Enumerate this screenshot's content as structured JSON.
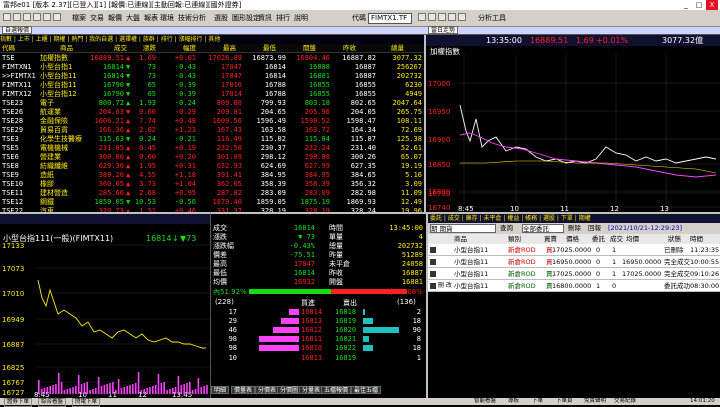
{
  "window": {
    "title": "富邦e01 [版本 2.37][已登入][1] [報價:已連線][主動回報:已連線][國外證券]",
    "min": "_",
    "max": "□",
    "close": "X"
  },
  "menu": {
    "items": [
      "檔案",
      "交易",
      "報價",
      "大盤",
      "報表",
      "環境",
      "技術分析",
      "選股",
      "圖形設定",
      "資訊",
      "排行",
      "說明"
    ],
    "code_label": "代碼",
    "code_value": "FIMTX1.TF",
    "analysis_label": "分析工具"
  },
  "panels": {
    "quote": "自選報價",
    "tick": "當日走勢",
    "kline": "技術分析",
    "order": "委託回報"
  },
  "quote": {
    "tabs": "指數 | 上市 | 上櫃 | 期權 | 熱門 | 我的自選 | 選擇權 | 族群 | 排行 | 漲幅排行 | 其他",
    "headers": [
      "代碼",
      "商品",
      "成交",
      "漲跌",
      "幅度",
      "最高",
      "最低",
      "開盤",
      "昨收",
      "總量"
    ],
    "rows": [
      {
        "code": "TSE",
        "name": "加權指數",
        "price": "16889.51",
        "arrow": "▲",
        "chg": "1.69",
        "pct": "+0.01",
        "hi": "17026.89",
        "lo": "16873.99",
        "open": "16904.46",
        "prev": "16887.82",
        "vol": "3077.32",
        "clr": "red"
      },
      {
        "code": "FIMTXN1",
        "name": "小型台指1",
        "price": "16814",
        "arrow": "▼",
        "chg": "73",
        "pct": "-0.43",
        "hi": "17047",
        "lo": "16814",
        "open": "16888",
        "prev": "16887",
        "vol": "256267",
        "clr": "grn"
      },
      {
        "code": ">>FIMTX1",
        "name": "小型台指11",
        "price": "16814",
        "arrow": "▼",
        "chg": "73",
        "pct": "-0.43",
        "hi": "17047",
        "lo": "16814",
        "open": "16881",
        "prev": "16887",
        "vol": "202732",
        "clr": "grn"
      },
      {
        "code": "FIMTX11",
        "name": "小型台指11",
        "price": "16790",
        "arrow": "▼",
        "chg": "65",
        "pct": "-0.39",
        "hi": "17016",
        "lo": "16788",
        "open": "16855",
        "prev": "16855",
        "vol": "6230",
        "clr": "grn"
      },
      {
        "code": "FIMTX12",
        "name": "小型台指12",
        "price": "16790",
        "arrow": "▼",
        "chg": "65",
        "pct": "-0.39",
        "hi": "17014",
        "lo": "16788",
        "open": "16855",
        "prev": "16855",
        "vol": "4949",
        "clr": "grn"
      },
      {
        "code": "TSE23",
        "name": "電子",
        "price": "800.72",
        "arrow": "▲",
        "chg": "1.93",
        "pct": "-0.24",
        "hi": "809.86",
        "lo": "799.93",
        "open": "803.18",
        "prev": "802.65",
        "vol": "2047.64",
        "clr": "grn"
      },
      {
        "code": "TSE26",
        "name": "航運業",
        "price": "204.63",
        "arrow": "▼",
        "chg": "0.60",
        "pct": "-0.29",
        "hi": "209.81",
        "lo": "204.65",
        "open": "205.96",
        "prev": "204.05",
        "vol": "265.75",
        "clr": "red"
      },
      {
        "code": "TSE28",
        "name": "金融保險",
        "price": "1606.21",
        "arrow": "▲",
        "chg": "7.74",
        "pct": "+0.48",
        "hi": "1609.56",
        "lo": "1596.49",
        "open": "1598.52",
        "prev": "1598.47",
        "vol": "108.11",
        "clr": "red"
      },
      {
        "code": "TSE29",
        "name": "貿易百貨",
        "price": "166.36",
        "arrow": "▲",
        "chg": "2.02",
        "pct": "+1.23",
        "hi": "167.43",
        "lo": "163.58",
        "open": "163.72",
        "prev": "164.34",
        "vol": "72.69",
        "clr": "red"
      },
      {
        "code": "TSE3",
        "name": "化學生技醫療",
        "price": "115.63",
        "arrow": "▼",
        "chg": "0.24",
        "pct": "-0.21",
        "hi": "116.49",
        "lo": "115.02",
        "prev": "115.87",
        "open": "115.84",
        "vol": "125.38",
        "clr": "grn"
      },
      {
        "code": "TSE5",
        "name": "電機機械",
        "price": "231.85",
        "arrow": "▲",
        "chg": "0.45",
        "pct": "+0.19",
        "hi": "232.50",
        "lo": "230.37",
        "open": "232.24",
        "prev": "231.40",
        "vol": "52.61",
        "clr": "red"
      },
      {
        "code": "TSE6",
        "name": "營建業",
        "price": "300.80",
        "arrow": "▲",
        "chg": "0.60",
        "pct": "+0.20",
        "hi": "301.09",
        "lo": "298.12",
        "open": "298.80",
        "prev": "300.26",
        "vol": "65.07",
        "clr": "red"
      },
      {
        "code": "TSE8",
        "name": "紡織纖維",
        "price": "629.30",
        "arrow": "▲",
        "chg": "1.95",
        "pct": "+0.31",
        "hi": "632.93",
        "lo": "624.69",
        "open": "627.99",
        "prev": "627.35",
        "vol": "19.19",
        "clr": "red"
      },
      {
        "code": "TSE9",
        "name": "造紙",
        "price": "389.20",
        "arrow": "▲",
        "chg": "4.55",
        "pct": "+1.18",
        "hi": "391.41",
        "lo": "384.95",
        "open": "384.95",
        "prev": "384.65",
        "vol": "5.16",
        "clr": "red"
      },
      {
        "code": "TSE10",
        "name": "橡膠",
        "price": "360.05",
        "arrow": "▲",
        "chg": "3.73",
        "pct": "+1.04",
        "hi": "362.05",
        "lo": "358.39",
        "open": "358.39",
        "prev": "356.32",
        "vol": "3.09",
        "clr": "red"
      },
      {
        "code": "TSE11",
        "name": "建材營造",
        "price": "285.66",
        "arrow": "▲",
        "chg": "2.68",
        "pct": "+0.95",
        "hi": "287.82",
        "lo": "283.09",
        "open": "283.09",
        "prev": "282.98",
        "vol": "11.09",
        "clr": "red"
      },
      {
        "code": "TSE12",
        "name": "鋼鐵",
        "price": "1859.05",
        "arrow": "▼",
        "chg": "10.53",
        "pct": "-0.56",
        "hi": "1879.40",
        "lo": "1859.05",
        "open": "1875.19",
        "prev": "1869.93",
        "vol": "12.49",
        "clr": "grn"
      },
      {
        "code": "TSE22",
        "name": "汽車",
        "price": "329.73",
        "arrow": "▲",
        "chg": "1.51",
        "pct": "+0.46",
        "hi": "331.37",
        "lo": "328.19",
        "open": "328.19",
        "prev": "328.24",
        "vol": "19.96",
        "clr": "red"
      }
    ]
  },
  "tick": {
    "name": "加權指數",
    "time": "13:35:00",
    "price": "16889.51",
    "arrow": "▲",
    "chg": "1.69",
    "pct": "+0.01%",
    "vol": "3077.32億",
    "yticks": [
      "17000",
      "16950",
      "16900",
      "16850",
      "16800",
      "16790",
      "16740"
    ],
    "xticks": [
      "8:45",
      "10",
      "11",
      "12",
      "13"
    ]
  },
  "kline": {
    "name": "小型台指111(一般)(FIMTX11)",
    "price": "16814",
    "arrow": "↓",
    "chg": "▼73",
    "yticks": [
      "17133",
      "17073",
      "17010",
      "16949",
      "16887",
      "16825",
      "16767",
      "16727"
    ],
    "xticks": [
      "8:45",
      "10",
      "11",
      "12",
      "13:45"
    ]
  },
  "detail": {
    "rows": [
      [
        "成交",
        "16814",
        "時間",
        "13:45:00"
      ],
      [
        "漲跌",
        "▼ 73",
        "單量",
        "4"
      ],
      [
        "漲跌幅",
        "-0.43%",
        "總量",
        "202732"
      ],
      [
        "價差",
        "-75.51",
        "昨量",
        "51289"
      ],
      [
        "最高",
        "17047",
        "未平倉",
        "24058"
      ],
      [
        "最低",
        "16814",
        "昨收",
        "16887"
      ],
      [
        "均價",
        "16932",
        "開盤",
        "16881"
      ]
    ],
    "ratio_left": "內51.92%",
    "ratio_right": "外 48.08%",
    "count_left": "(228)",
    "count_right": "(136)",
    "buy": "買進",
    "sell": "賣出",
    "book": [
      [
        "17",
        "16814",
        "16818",
        "2"
      ],
      [
        "29",
        "16813",
        "16819",
        "18"
      ],
      [
        "46",
        "16812",
        "16820",
        "90"
      ],
      [
        "98",
        "16811",
        "16821",
        "8"
      ],
      [
        "98",
        "16810",
        "16822",
        "18"
      ]
    ],
    "total": [
      "10",
      "16813",
      "16819",
      "1"
    ],
    "tabs": [
      "明細",
      "價量表",
      "分價表",
      "分價圖",
      "分量表",
      "五檔報價",
      "最佳五檔"
    ]
  },
  "order": {
    "tabs": "委託 | 成交 | 庫存 | 未平倉 | 權益 | 帳務 | 選股 | 下單 | 期權",
    "account": "期 期貨",
    "query": "查詢",
    "filter": "全部委託",
    "delete": "刪除",
    "tag": "回報",
    "date": "[2021/10/21-12:29:23]",
    "headers": [
      "",
      "商品",
      "類別",
      "買賣",
      "價格",
      "委託",
      "成交",
      "均價",
      "狀態",
      "時間"
    ],
    "rows": [
      {
        "item": "小型台指11",
        "type": "新倉ROD",
        "side": "買",
        "price": "17025.0000",
        "qty": "0",
        "done": "1",
        "avg": "",
        "status": "已刪除",
        "time": "11:23:35"
      },
      {
        "item": "小型台指11",
        "type": "新倉ROD",
        "side": "買",
        "price": "16950.0000",
        "qty": "0",
        "done": "1",
        "avg": "16950.0000",
        "status": "完全成交",
        "time": "10:00:55"
      },
      {
        "item": "小型台指11",
        "type": "新倉ROD",
        "side": "賣",
        "price": "17025.0000",
        "qty": "0",
        "done": "1",
        "avg": "17025.0000",
        "status": "完全成交",
        "time": "09:10:26"
      },
      {
        "item": "小型台指11",
        "type": "新倉ROD",
        "side": "賣",
        "price": "16800.0000",
        "qty": "1",
        "done": "0",
        "avg": "",
        "status": "委託成功",
        "time": "08:30:00",
        "edit": "刪 改"
      }
    ]
  },
  "status": {
    "left": [
      "證券下單",
      "綜合看盤",
      "閃電下單"
    ],
    "right": [
      "智能看盤",
      "導板",
      "下單",
      "下單頁",
      "免責聲明",
      "交易紀錄",
      "14:01:20"
    ]
  }
}
